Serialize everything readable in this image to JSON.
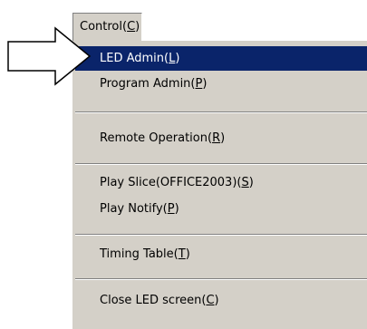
{
  "menubar": {
    "control": {
      "text": "Control(",
      "mnemonic": "C",
      "suffix": ")"
    }
  },
  "menu": {
    "led_admin": {
      "text": "LED Admin(",
      "mnemonic": "L",
      "suffix": ")"
    },
    "program_admin": {
      "text": "Program Admin(",
      "mnemonic": "P",
      "suffix": ")"
    },
    "remote_operation": {
      "text": "Remote Operation(",
      "mnemonic": "R",
      "suffix": ")"
    },
    "play_slice": {
      "text": "Play Slice(OFFICE2003)(",
      "mnemonic": "S",
      "suffix": ")"
    },
    "play_notify": {
      "text": "Play Notify(",
      "mnemonic": "P",
      "suffix": ")"
    },
    "timing_table": {
      "text": "Timing Table(",
      "mnemonic": "T",
      "suffix": ")"
    },
    "close_led_screen": {
      "text": "Close LED screen(",
      "mnemonic": "C",
      "suffix": ")"
    }
  },
  "colors": {
    "menu_background": "#d4d0c8",
    "highlight_background": "#0a246a",
    "highlight_text": "#ffffff"
  },
  "icons": {
    "pointer": "arrow-pointer-icon"
  }
}
